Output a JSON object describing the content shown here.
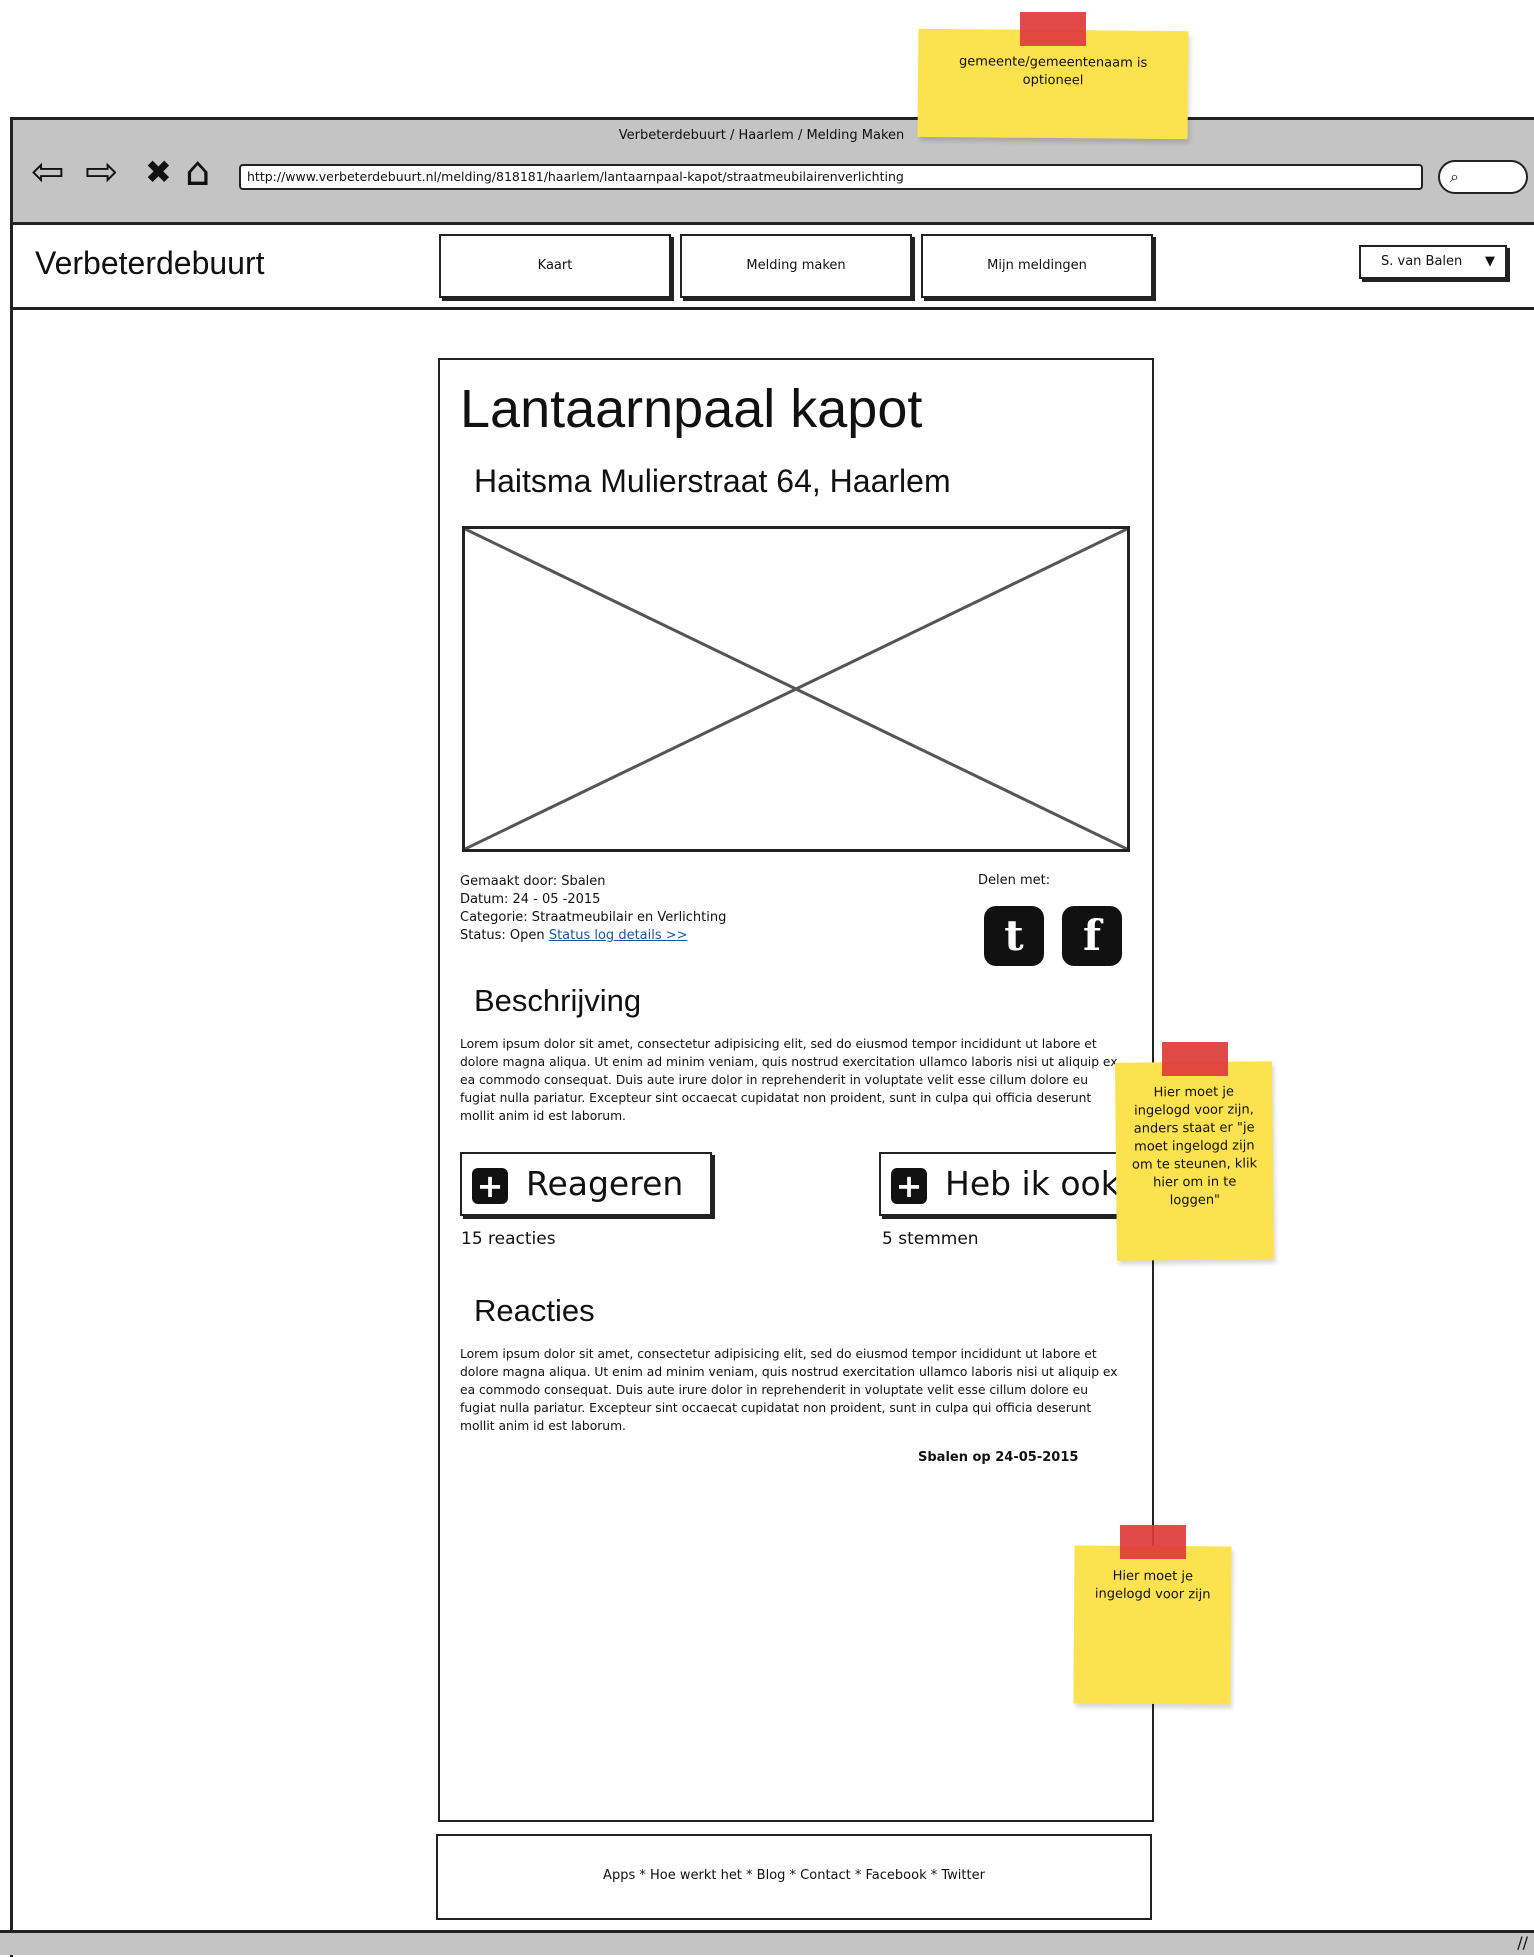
{
  "browser": {
    "window_title": "Verbeterdebuurt / Haarlem / Melding Maken",
    "url": "http://www.verbeterdebuurt.nl/melding/818181/haarlem/lantaarnpaal-kapot/straatmeubilairenverlichting",
    "back_glyph": "⇦",
    "forward_glyph": "⇨",
    "stop_glyph": "✖",
    "home_glyph": "⌂",
    "search_glyph": "⌕"
  },
  "header": {
    "brand": "Verbeterdebuurt",
    "tabs": [
      "Kaart",
      "Melding maken",
      "Mijn meldingen"
    ],
    "user": "S. van Balen",
    "caret": "▼"
  },
  "report": {
    "title": "Lantaarnpaal kapot",
    "address": "Haitsma Mulierstraat 64, Haarlem",
    "made_by": "Gemaakt door: Sbalen",
    "date": "Datum: 24 - 05 -2015",
    "category": "Categorie: Straatmeubilair en Verlichting",
    "status": "Status: Open",
    "status_link": "Status log details >>",
    "share_label": "Delen met:",
    "twitter_glyph": "t",
    "facebook_glyph": "f"
  },
  "description": {
    "heading": "Beschrijving",
    "text": "Lorem ipsum dolor sit amet, consectetur adipisicing elit, sed do eiusmod tempor incididunt ut labore et dolore magna aliqua. Ut enim ad minim veniam, quis nostrud exercitation ullamco laboris nisi ut aliquip ex ea commodo consequat. Duis aute irure dolor in reprehenderit in voluptate velit esse cillum dolore eu fugiat nulla pariatur. Excepteur sint occaecat cupidatat non proident, sunt in culpa qui officia deserunt mollit anim id est laborum."
  },
  "actions": {
    "plus_glyph": "+",
    "react_label": "Reageren",
    "react_count": "15 reacties",
    "support_label": "Heb ik ook",
    "support_count": "5 stemmen"
  },
  "reactions": {
    "heading": "Reacties",
    "text": "Lorem ipsum dolor sit amet, consectetur adipisicing elit, sed do eiusmod tempor incididunt ut labore et dolore magna aliqua. Ut enim ad minim veniam, quis nostrud exercitation ullamco laboris nisi ut aliquip ex ea commodo consequat. Duis aute irure dolor in reprehenderit in voluptate velit esse cillum dolore eu fugiat nulla pariatur. Excepteur sint occaecat cupidatat non proident, sunt in culpa qui officia deserunt mollit anim id est laborum.",
    "signature": "Sbalen op 24-05-2015"
  },
  "footer": {
    "links": "Apps * Hoe werkt het * Blog * Contact * Facebook * Twitter"
  },
  "notes": {
    "top": "gemeente/gemeentenaam is optioneel",
    "middle": "Hier moet je ingelogd voor zijn, anders staat er \"je moet ingelogd zijn om te steunen, klik hier om in te loggen\"",
    "bottom": "Hier moet je ingelogd voor zijn"
  },
  "colors": {
    "chrome": "#c4c4c4",
    "sticky_note": "#fde24f",
    "tape": "#e03b3b",
    "link": "#1a56a8"
  }
}
